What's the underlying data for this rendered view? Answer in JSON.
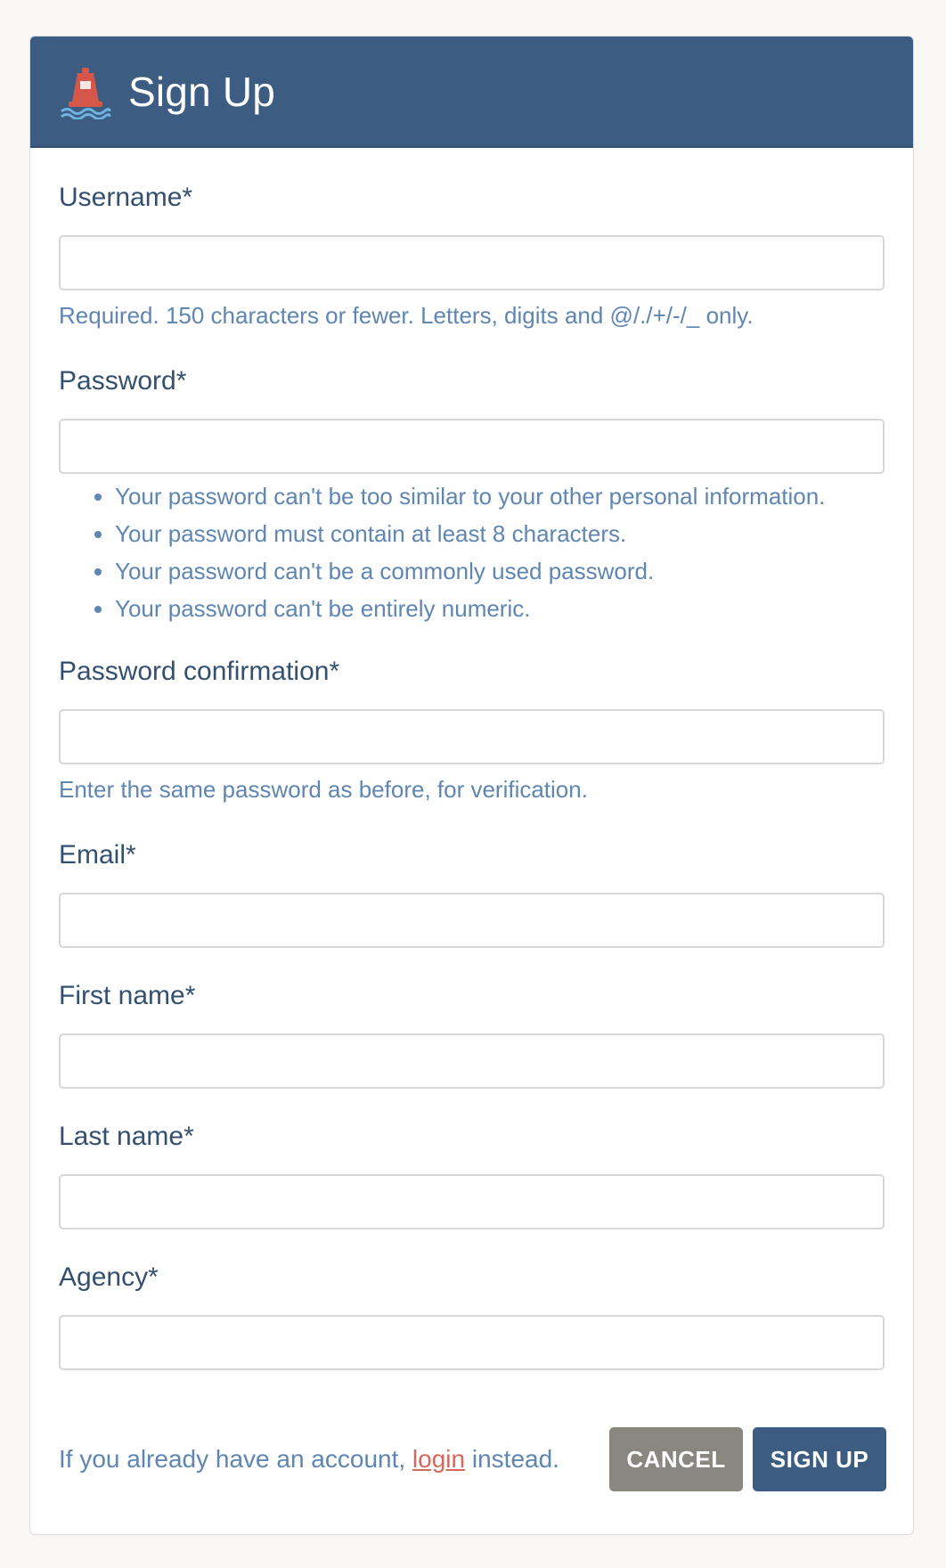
{
  "header": {
    "title": "Sign Up",
    "icon": "buoy-icon"
  },
  "form": {
    "username": {
      "label": "Username*",
      "value": "",
      "help": "Required. 150 characters or fewer. Letters, digits and @/./+/-/_ only."
    },
    "password": {
      "label": "Password*",
      "value": "",
      "rules": [
        "Your password can't be too similar to your other personal information.",
        "Your password must contain at least 8 characters.",
        "Your password can't be a commonly used password.",
        "Your password can't be entirely numeric."
      ]
    },
    "password_confirmation": {
      "label": "Password confirmation*",
      "value": "",
      "help": "Enter the same password as before, for verification."
    },
    "email": {
      "label": "Email*",
      "value": ""
    },
    "first_name": {
      "label": "First name*",
      "value": ""
    },
    "last_name": {
      "label": "Last name*",
      "value": ""
    },
    "agency": {
      "label": "Agency*",
      "value": ""
    }
  },
  "footer": {
    "text_before": "If you already have an account, ",
    "login_link": "login",
    "text_after": " instead.",
    "cancel_label": "CANCEL",
    "signup_label": "SIGN UP"
  },
  "colors": {
    "header_bg": "#3d5c82",
    "label": "#34506f",
    "help": "#5f86b3",
    "link": "#d4685c",
    "cancel_bg": "#8a8680",
    "signup_bg": "#3d5c82"
  }
}
